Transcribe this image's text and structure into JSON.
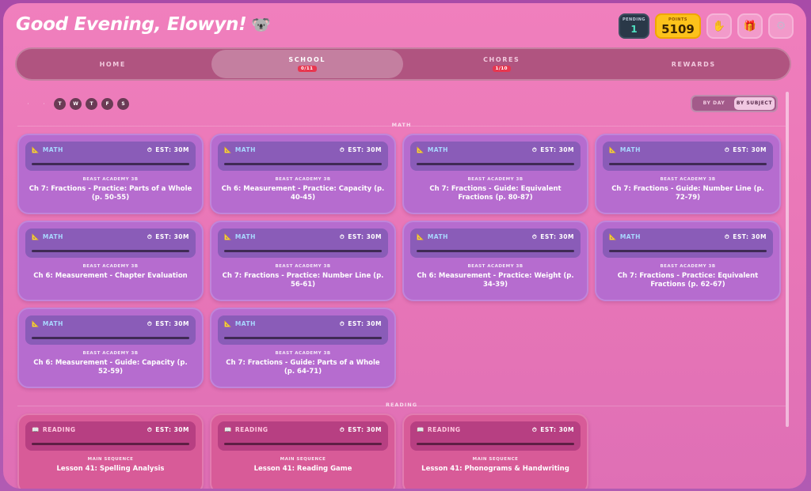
{
  "header": {
    "greeting": "Good Evening, Elowyn!",
    "greeting_emoji": "🐨",
    "pending_label": "PENDING",
    "pending_value": "1",
    "points_label": "POINTS",
    "points_value": "5109",
    "icons": [
      "hand-icon",
      "gift-icon",
      "gear-icon"
    ]
  },
  "nav": {
    "tabs": [
      {
        "label": "HOME",
        "badge": ""
      },
      {
        "label": "SCHOOL",
        "badge": "0/11"
      },
      {
        "label": "CHORES",
        "badge": "1/10"
      },
      {
        "label": "REWARDS",
        "badge": ""
      }
    ]
  },
  "days": [
    "·",
    "·",
    "T",
    "W",
    "T",
    "F",
    "S"
  ],
  "view_toggle": {
    "by_day": "BY DAY",
    "by_subject": "BY SUBJECT"
  },
  "sections": {
    "math": {
      "label": "MATH",
      "cards": [
        {
          "subject": "MATH",
          "est": "EST: 30M",
          "category": "BEAST ACADEMY 3B",
          "title": "Ch 7: Fractions - Practice: Parts of a Whole (p. 50-55)"
        },
        {
          "subject": "MATH",
          "est": "EST: 30M",
          "category": "BEAST ACADEMY 3B",
          "title": "Ch 6: Measurement - Practice: Capacity (p. 40-45)"
        },
        {
          "subject": "MATH",
          "est": "EST: 30M",
          "category": "BEAST ACADEMY 3B",
          "title": "Ch 7: Fractions - Guide: Equivalent Fractions (p. 80-87)"
        },
        {
          "subject": "MATH",
          "est": "EST: 30M",
          "category": "BEAST ACADEMY 3B",
          "title": "Ch 7: Fractions - Guide: Number Line (p. 72-79)"
        },
        {
          "subject": "MATH",
          "est": "EST: 30M",
          "category": "BEAST ACADEMY 3B",
          "title": "Ch 6: Measurement - Chapter Evaluation"
        },
        {
          "subject": "MATH",
          "est": "EST: 30M",
          "category": "BEAST ACADEMY 3B",
          "title": "Ch 7: Fractions - Practice: Number Line (p. 56-61)"
        },
        {
          "subject": "MATH",
          "est": "EST: 30M",
          "category": "BEAST ACADEMY 3B",
          "title": "Ch 6: Measurement - Practice: Weight (p. 34-39)"
        },
        {
          "subject": "MATH",
          "est": "EST: 30M",
          "category": "BEAST ACADEMY 3B",
          "title": "Ch 7: Fractions - Practice: Equivalent Fractions (p. 62-67)"
        },
        {
          "subject": "MATH",
          "est": "EST: 30M",
          "category": "BEAST ACADEMY 3B",
          "title": "Ch 6: Measurement - Guide: Capacity (p. 52-59)"
        },
        {
          "subject": "MATH",
          "est": "EST: 30M",
          "category": "BEAST ACADEMY 3B",
          "title": "Ch 7: Fractions - Guide: Parts of a Whole (p. 64-71)"
        }
      ]
    },
    "reading": {
      "label": "READING",
      "cards": [
        {
          "subject": "READING",
          "est": "EST: 30M",
          "category": "MAIN SEQUENCE",
          "title": "Lesson 41: Spelling Analysis"
        },
        {
          "subject": "READING",
          "est": "EST: 30M",
          "category": "MAIN SEQUENCE",
          "title": "Lesson 41: Reading Game"
        },
        {
          "subject": "READING",
          "est": "EST: 30M",
          "category": "MAIN SEQUENCE",
          "title": "Lesson 41: Phonograms & Handwriting"
        }
      ]
    }
  }
}
